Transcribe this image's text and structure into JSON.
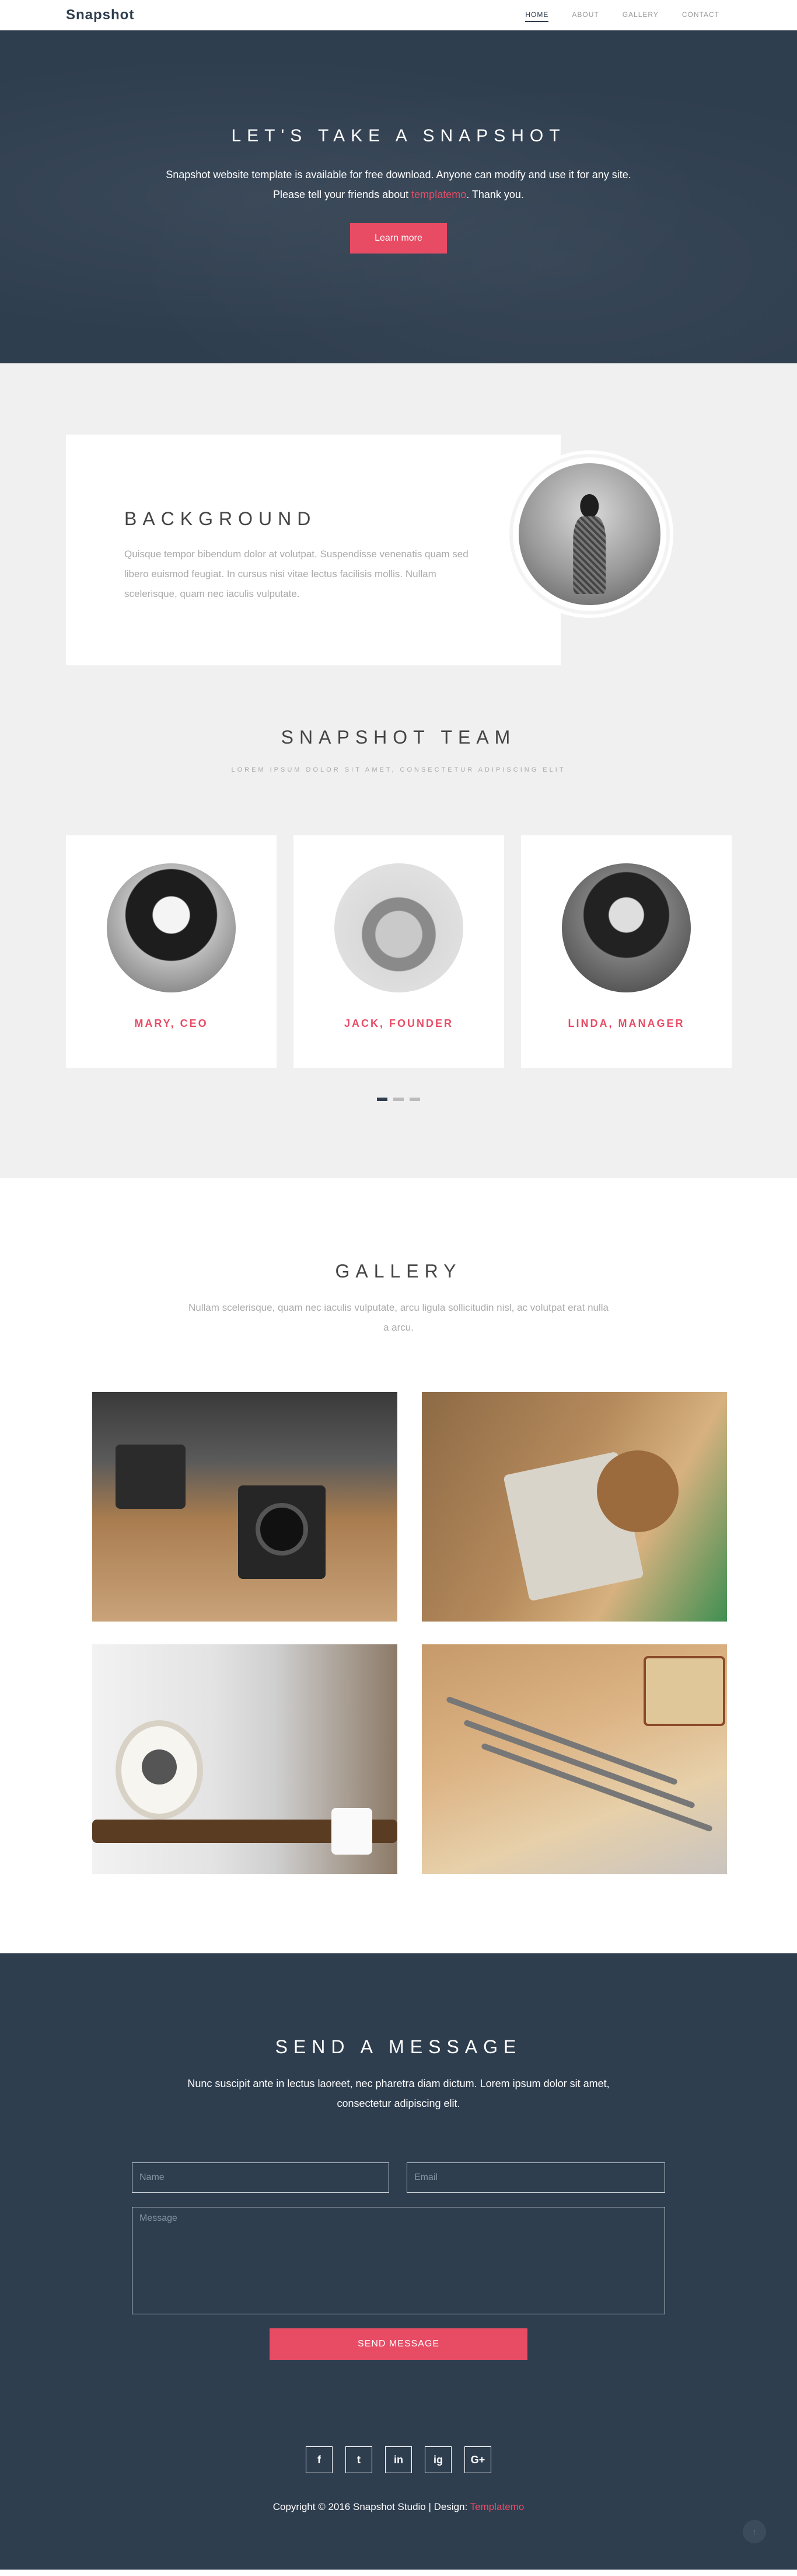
{
  "nav": {
    "brand": "Snapshot",
    "items": [
      "HOME",
      "ABOUT",
      "GALLERY",
      "CONTACT"
    ]
  },
  "hero": {
    "title": "LET'S TAKE A SNAPSHOT",
    "text_before": "Snapshot website template is available for free download. Anyone can modify and use it for any site. Please tell your friends about ",
    "link": "templatemo",
    "text_after": ". Thank you.",
    "button": "Learn more"
  },
  "about": {
    "title": "BACKGROUND",
    "text": "Quisque tempor bibendum dolor at volutpat. Suspendisse venenatis quam sed libero euismod feugiat. In cursus nisi vitae lectus facilisis mollis. Nullam scelerisque, quam nec iaculis vulputate."
  },
  "team": {
    "title": "SNAPSHOT TEAM",
    "subtitle": "LOREM IPSUM DOLOR SIT AMET, CONSECTETUR ADIPISCING ELIT",
    "members": [
      {
        "name": "MARY, CEO"
      },
      {
        "name": "JACK, FOUNDER"
      },
      {
        "name": "LINDA, MANAGER"
      }
    ],
    "carousel_dots": 3,
    "active_dot": 1
  },
  "gallery": {
    "title": "GALLERY",
    "text": "Nullam scelerisque, quam nec iaculis vulputate, arcu ligula sollicitudin nisl, ac volutpat erat nulla a arcu."
  },
  "contact": {
    "title": "SEND A MESSAGE",
    "text": "Nunc suscipit ante in lectus laoreet, nec pharetra diam dictum. Lorem ipsum dolor sit amet, consectetur adipiscing elit.",
    "name_placeholder": "Name",
    "email_placeholder": "Email",
    "message_placeholder": "Message",
    "button": "SEND MESSAGE"
  },
  "footer": {
    "socials": [
      "f",
      "t",
      "in",
      "ig",
      "G+"
    ],
    "copyright": "Copyright © 2016 Snapshot Studio | Design: ",
    "design_link": "Templatemo"
  },
  "colors": {
    "accent": "#e84c65",
    "dark": "#2f3e4f",
    "light_bg": "#f0f0f0"
  }
}
